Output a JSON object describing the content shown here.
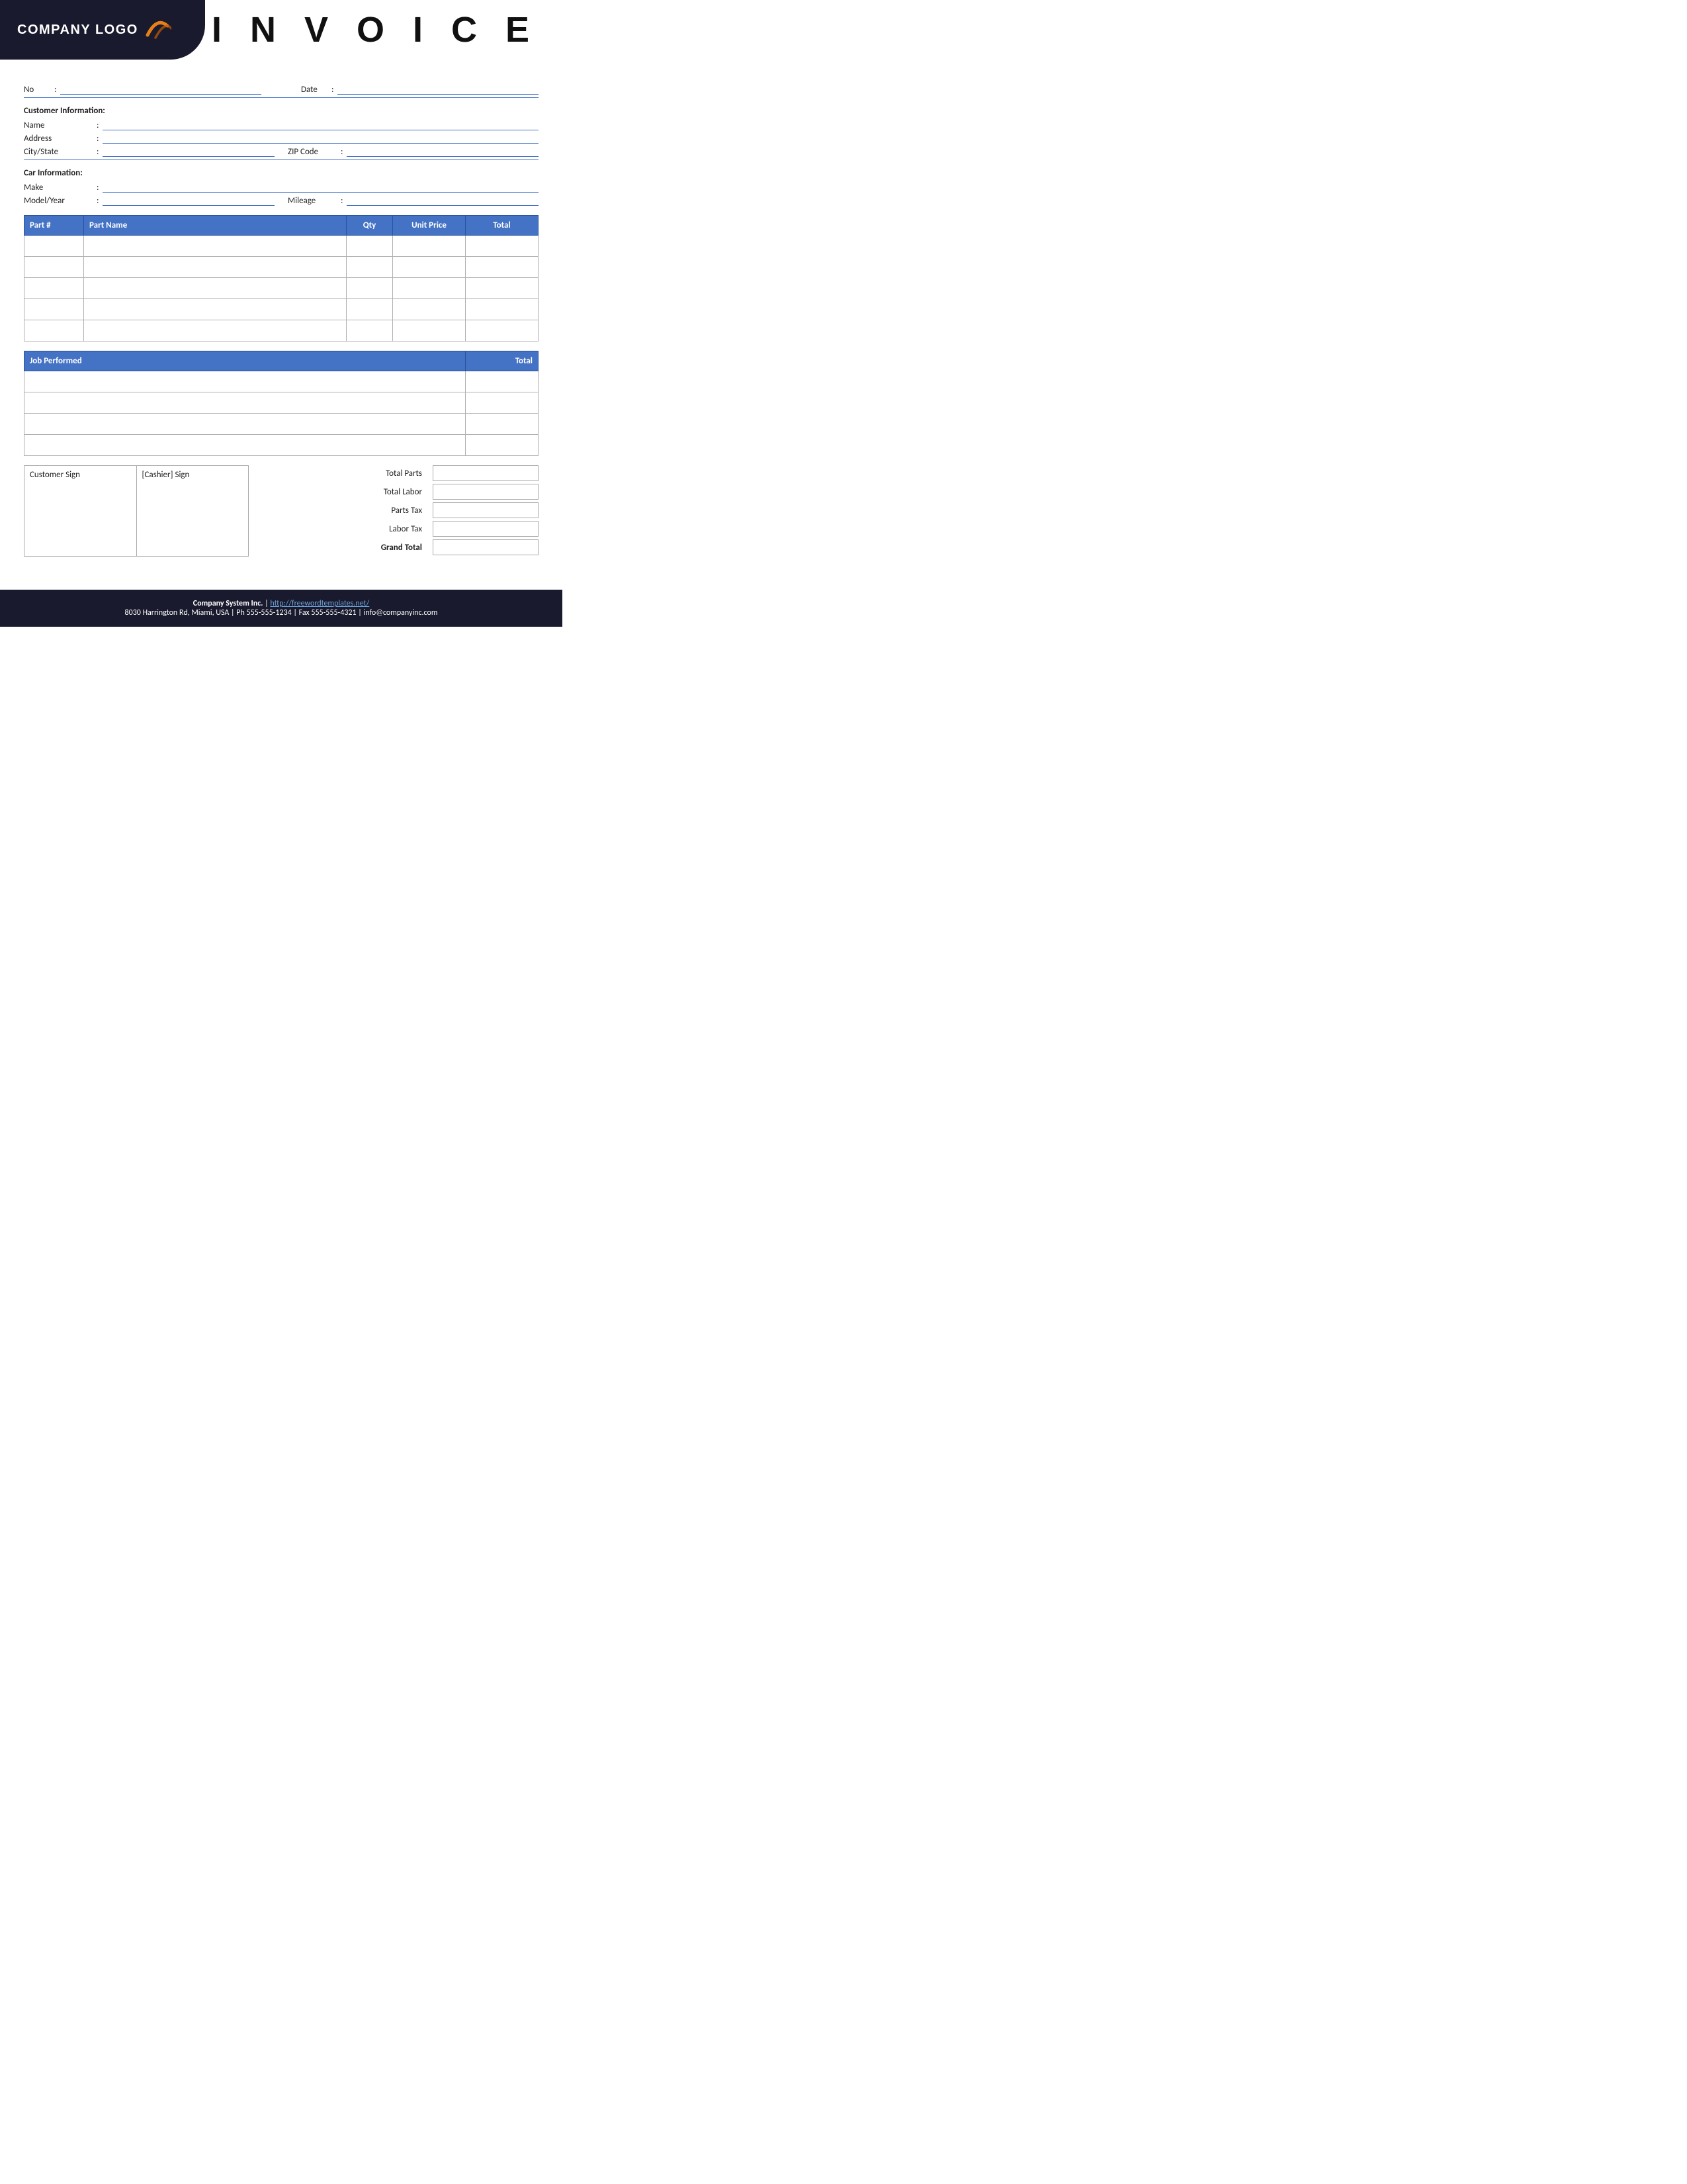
{
  "header": {
    "logo_text": "COMPANY LOGO",
    "invoice_title": "I N V O I C E"
  },
  "top_info": {
    "no_label": "No",
    "no_colon": ":",
    "date_label": "Date",
    "date_colon": ":"
  },
  "customer_section": {
    "header": "Customer Information:",
    "name_label": "Name",
    "name_colon": ":",
    "address_label": "Address",
    "address_colon": ":",
    "city_state_label": "City/State",
    "city_state_colon": ":",
    "zip_label": "ZIP Code",
    "zip_colon": ":"
  },
  "car_section": {
    "header": "Car Information:",
    "make_label": "Make",
    "make_colon": ":",
    "model_year_label": "Model/Year",
    "model_year_colon": ":",
    "mileage_label": "Mileage",
    "mileage_colon": ":"
  },
  "parts_table": {
    "columns": [
      "Part #",
      "Part Name",
      "Qty",
      "Unit Price",
      "Total"
    ],
    "rows": [
      {
        "part_num": "",
        "part_name": "",
        "qty": "",
        "unit_price": "",
        "total": ""
      },
      {
        "part_num": "",
        "part_name": "",
        "qty": "",
        "unit_price": "",
        "total": ""
      },
      {
        "part_num": "",
        "part_name": "",
        "qty": "",
        "unit_price": "",
        "total": ""
      },
      {
        "part_num": "",
        "part_name": "",
        "qty": "",
        "unit_price": "",
        "total": ""
      },
      {
        "part_num": "",
        "part_name": "",
        "qty": "",
        "unit_price": "",
        "total": ""
      }
    ]
  },
  "job_table": {
    "columns": [
      "Job Performed",
      "Total"
    ],
    "rows": [
      {
        "job": "",
        "total": ""
      },
      {
        "job": "",
        "total": ""
      },
      {
        "job": "",
        "total": ""
      },
      {
        "job": "",
        "total": ""
      }
    ]
  },
  "sign_section": {
    "customer_sign_label": "Customer Sign",
    "cashier_sign_label": "[Cashier] Sign"
  },
  "totals": {
    "total_parts_label": "Total Parts",
    "total_labor_label": "Total Labor",
    "parts_tax_label": "Parts Tax",
    "labor_tax_label": "Labor Tax",
    "grand_total_label": "Grand Total",
    "total_parts_value": "",
    "total_labor_value": "",
    "parts_tax_value": "",
    "labor_tax_value": "",
    "grand_total_value": ""
  },
  "footer": {
    "company_name": "Company System Inc.",
    "separator": "|",
    "website": "http://freewordtemplates.net/",
    "address_line": "8030 Harrington Rd, Miami, USA | Ph 555-555-1234 | Fax 555-555-4321 | info@companyinc.com"
  }
}
